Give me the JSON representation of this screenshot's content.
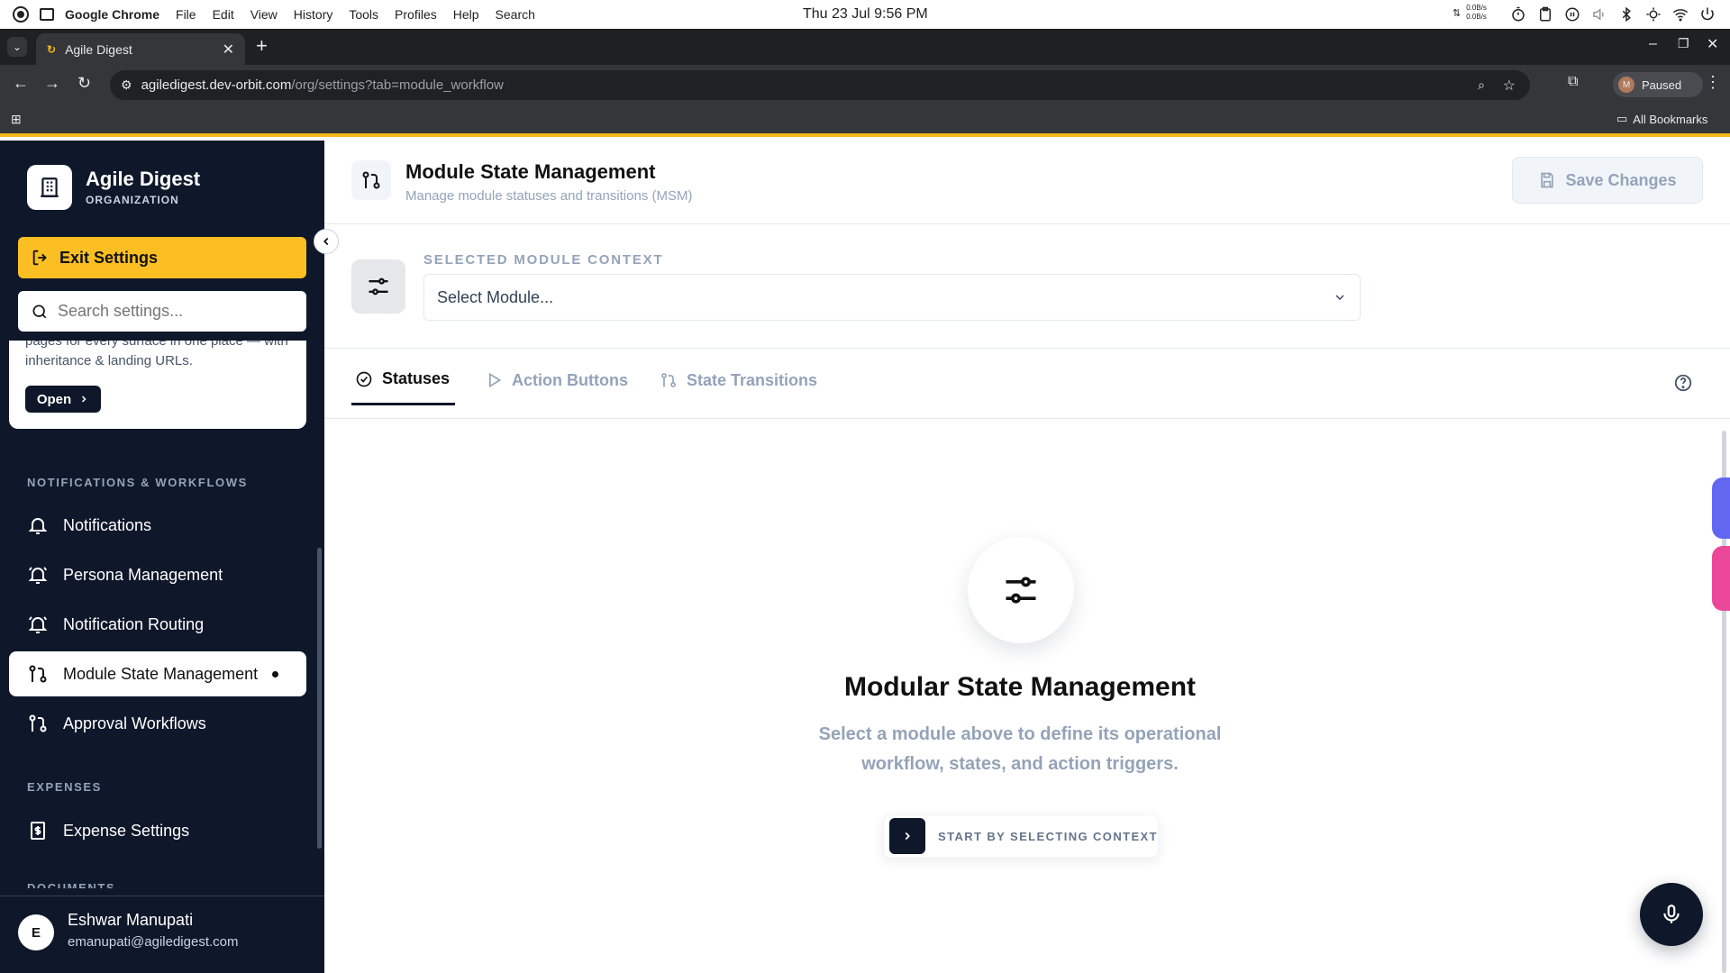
{
  "os_bar": {
    "app_name": "Google Chrome",
    "menu": [
      "File",
      "Edit",
      "View",
      "History",
      "Tools",
      "Profiles",
      "Help",
      "Search"
    ],
    "datetime": "Thu 23 Jul  9:56 PM",
    "net_up": "0.0B/s",
    "net_down": "0.0B/s"
  },
  "browser": {
    "tab_title": "Agile Digest",
    "url_domain": "agiledigest.dev-orbit.com",
    "url_path": "/org/settings?tab=module_workflow",
    "profile_initial": "M",
    "profile_status": "Paused",
    "bookmarks_label": "All Bookmarks"
  },
  "sidebar": {
    "org_name": "Agile Digest",
    "org_type": "ORGANIZATION",
    "exit_label": "Exit Settings",
    "search_placeholder": "Search settings...",
    "promo_text_top": "pages for every surface in one place — with",
    "promo_text_bottom": "inheritance & landing URLs.",
    "promo_button": "Open",
    "section_notifications": "NOTIFICATIONS & WORKFLOWS",
    "items": [
      {
        "label": "Notifications",
        "icon": "bell-icon"
      },
      {
        "label": "Persona Management",
        "icon": "bell-ring-icon"
      },
      {
        "label": "Notification Routing",
        "icon": "bell-ring-icon"
      },
      {
        "label": "Module State Management",
        "icon": "git-pull-request-icon",
        "active": true
      },
      {
        "label": "Approval Workflows",
        "icon": "git-pull-request-icon"
      }
    ],
    "section_expenses": "EXPENSES",
    "expense_item": "Expense Settings",
    "section_documents": "DOCUMENTS",
    "user": {
      "initial": "E",
      "name": "Eshwar Manupati",
      "email": "emanupati@agiledigest.com"
    }
  },
  "header": {
    "title": "Module State Management",
    "subtitle": "Manage module statuses and transitions (MSM)",
    "save_label": "Save Changes"
  },
  "context": {
    "label": "SELECTED MODULE CONTEXT",
    "select_value": "Select Module..."
  },
  "tabs": [
    {
      "label": "Statuses",
      "active": true
    },
    {
      "label": "Action Buttons"
    },
    {
      "label": "State Transitions"
    }
  ],
  "empty_state": {
    "title": "Modular State Management",
    "line1": "Select a module above to define its operational",
    "line2": "workflow, states, and action triggers.",
    "cta": "START BY SELECTING CONTEXT"
  },
  "colors": {
    "accent": "#fbbf24",
    "sidebar_bg": "#0f172a",
    "active_item_bg": "#ffffff"
  }
}
